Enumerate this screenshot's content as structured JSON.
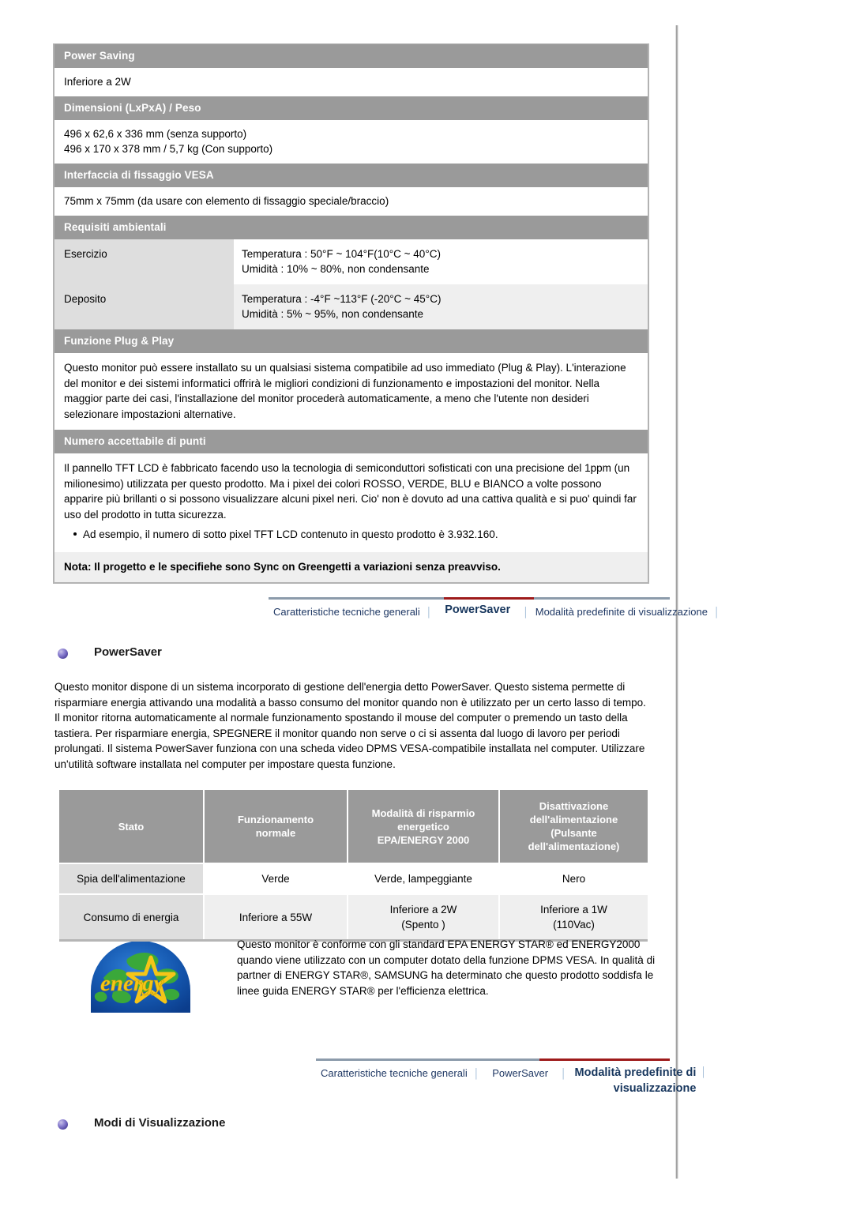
{
  "spec_table": {
    "sections": [
      {
        "kind": "head",
        "title": "Power Saving"
      },
      {
        "kind": "body",
        "text": "Inferiore a 2W"
      },
      {
        "kind": "head",
        "title": "Dimensioni (LxPxA) / Peso"
      },
      {
        "kind": "body2",
        "line1": "496 x 62,6 x 336 mm (senza supporto)",
        "line2": "496 x 170 x 378 mm / 5,7 kg (Con supporto)"
      },
      {
        "kind": "head",
        "title": "Interfaccia di fissaggio VESA"
      },
      {
        "kind": "body",
        "text": "75mm x 75mm (da usare con elemento di fissaggio speciale/braccio)"
      },
      {
        "kind": "head",
        "title": "Requisiti ambientali"
      }
    ],
    "env_rows": [
      {
        "key": "Esercizio",
        "line1": "Temperatura : 50°F ~ 104°F(10°C ~ 40°C)",
        "line2": "Umidità : 10% ~ 80%, non condensante"
      },
      {
        "key": "Deposito",
        "line1": "Temperatura : -4°F ~113°F (-20°C ~ 45°C)",
        "line2": "Umidità : 5% ~ 95%, non condensante"
      }
    ],
    "plug_play": {
      "title": "Funzione Plug & Play",
      "text": "Questo monitor può essere installato su un qualsiasi sistema compatibile ad uso immediato (Plug & Play). L'interazione del monitor e dei sistemi informatici offrirà le migliori condizioni di funzionamento e impostazioni del monitor. Nella maggior parte dei casi, l'installazione del monitor procederà automaticamente, a meno che l'utente non desideri selezionare impostazioni alternative."
    },
    "dots": {
      "title": "Numero accettabile di punti",
      "text": "Il pannello TFT LCD è fabbricato facendo uso la tecnologia di semiconduttori sofisticati con una precisione del 1ppm (un milionesimo) utilizzata per questo prodotto. Ma i pixel dei colori ROSSO, VERDE, BLU e BIANCO a volte possono apparire più brillanti o si possono visualizzare alcuni pixel neri. Cio' non è dovuto ad una cattiva qualità e si puo' quindi far uso del prodotto in tutta sicurezza.",
      "bullet": "Ad esempio, il numero di sotto pixel TFT LCD contenuto in questo prodotto è 3.932.160."
    },
    "note": "Nota: Il progetto e le specifiehe sono Sync on Greengetti a variazioni senza preavviso."
  },
  "nav_top": {
    "tabs": [
      {
        "label": "Caratteristiche tecniche generali",
        "active": false
      },
      {
        "label": "PowerSaver",
        "active": true
      },
      {
        "label": "Modalità predefinite di visualizzazione",
        "active": false
      }
    ],
    "separator": "│",
    "rule_gray_color": "#8c9bab",
    "rule_active_color": "#9e1b1b"
  },
  "powersaver": {
    "heading": "PowerSaver",
    "paragraph": "Questo monitor dispone di un sistema incorporato di gestione dell'energia detto PowerSaver. Questo sistema permette di risparmiare energia attivando una modalità a basso consumo del monitor quando non è utilizzato per un certo lasso di tempo. Il monitor ritorna automaticamente al normale funzionamento spostando il mouse del computer o premendo un tasto della tastiera. Per risparmiare energia, SPEGNERE il monitor quando non serve o ci si assenta dal luogo di lavoro per periodi prolungati. Il sistema PowerSaver funziona con una scheda video DPMS VESA-compatibile installata nel computer. Utilizzare un'utilità software installata nel computer per impostare questa funzione.",
    "table": {
      "headers": [
        "Stato",
        "Funzionamento\nnormale",
        "Modalità di risparmio\nenergetico\nEPA/ENERGY 2000",
        "Disattivazione\ndell'alimentazione\n(Pulsante\ndell'alimentazione)"
      ],
      "rows": [
        {
          "label": "Spia dell'alimentazione",
          "normale": "Verde",
          "risparmio": "Verde, lampeggiante",
          "disattivazione": "Nero"
        },
        {
          "label": "Consumo di energia",
          "normale": "Inferiore a 55W",
          "risparmio": "Inferiore a 2W\n(Spento )",
          "disattivazione": "Inferiore a 1W\n(110Vac)"
        }
      ]
    },
    "energy_star": {
      "logo_word": "energy",
      "logo_alt": "energy-star-logo",
      "text": "Questo monitor è conforme con gli standard EPA ENERGY STAR® ed ENERGY2000 quando viene utilizzato con un computer dotato della funzione DPMS VESA. In qualità di partner di ENERGY STAR®, SAMSUNG ha determinato che questo prodotto soddisfa le linee guida ENERGY STAR® per l'efficienza elettrica."
    }
  },
  "nav_bottom": {
    "tabs": [
      {
        "label": "Caratteristiche tecniche generali",
        "active": false
      },
      {
        "label": "PowerSaver",
        "active": false
      },
      {
        "label": "Modalità predefinite di",
        "label2": "visualizzazione",
        "active": true
      }
    ],
    "separator": "│"
  },
  "display_modes": {
    "heading": "Modi di Visualizzazione"
  },
  "colors": {
    "section_header_bg": "#9a9a9a",
    "row_label_bg": "#dedede",
    "row_alt_bg": "#efefef",
    "nav_link": "#1f3864",
    "nav_active_rule": "#9e1b1b",
    "orb": "#5b4fa8"
  }
}
